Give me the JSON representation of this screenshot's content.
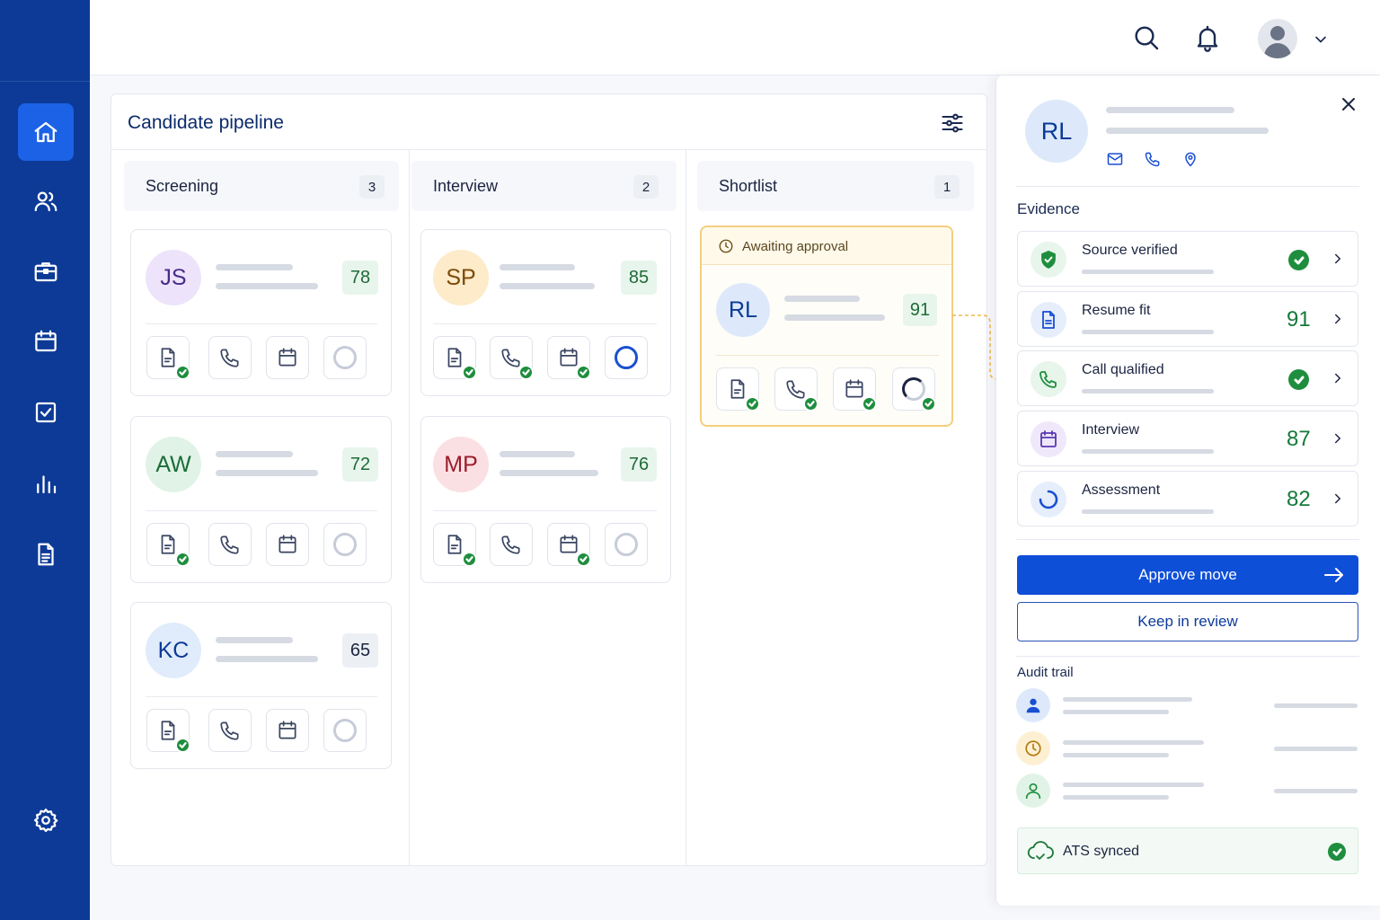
{
  "colors": {
    "sidebar": "#0c3a96",
    "accent": "#0e4fd8",
    "success": "#1e8e3e",
    "awaiting": "#f4cf7e"
  },
  "sidebar": {
    "items": [
      {
        "icon": "home-icon",
        "active": true
      },
      {
        "icon": "users-icon",
        "active": false
      },
      {
        "icon": "briefcase-icon",
        "active": false
      },
      {
        "icon": "calendar-icon",
        "active": false
      },
      {
        "icon": "checkbox-icon",
        "active": false
      },
      {
        "icon": "bar-chart-icon",
        "active": false
      },
      {
        "icon": "document-icon",
        "active": false
      }
    ],
    "footer_icon": "settings-icon"
  },
  "topbar": {
    "icons": [
      "search-icon",
      "bell-icon",
      "avatar",
      "chevron-down-icon"
    ]
  },
  "pipeline": {
    "title": "Candidate pipeline",
    "columns": [
      {
        "label": "Screening",
        "count": "3"
      },
      {
        "label": "Interview",
        "count": "2"
      },
      {
        "label": "Shortlist",
        "count": "1"
      }
    ],
    "cards": {
      "js": {
        "initials": "JS",
        "score": "78"
      },
      "aw": {
        "initials": "AW",
        "score": "72"
      },
      "kc": {
        "initials": "KC",
        "score": "65"
      },
      "sp": {
        "initials": "SP",
        "score": "85"
      },
      "mp": {
        "initials": "MP",
        "score": "76"
      },
      "rl": {
        "initials": "RL",
        "score": "91",
        "status": "Awaiting approval"
      }
    }
  },
  "panel": {
    "initials": "RL",
    "evidence_label": "Evidence",
    "evidence": [
      {
        "name": "Source verified",
        "value": ""
      },
      {
        "name": "Resume fit",
        "value": "91"
      },
      {
        "name": "Call qualified",
        "value": ""
      },
      {
        "name": "Interview",
        "value": "87"
      },
      {
        "name": "Assessment",
        "value": "82"
      }
    ],
    "approve_label": "Approve move",
    "keep_label": "Keep in review",
    "audit_label": "Audit trail",
    "ats_label": "ATS synced"
  }
}
